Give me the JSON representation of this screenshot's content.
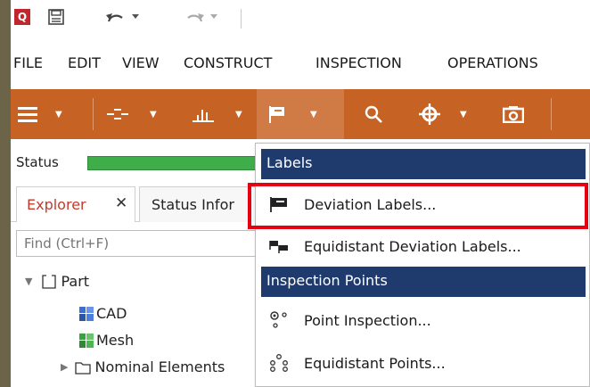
{
  "quick_access": {
    "logo_letter": "Q"
  },
  "menu": {
    "items": [
      "FILE",
      "EDIT",
      "VIEW",
      "CONSTRUCT",
      "INSPECTION",
      "OPERATIONS"
    ]
  },
  "toolbar": {
    "items": [
      "menu-icon",
      "align-icon",
      "chart-icon",
      "labels-icon",
      "search-icon",
      "crosshair-icon",
      "camera-icon"
    ],
    "active_item": "labels-icon"
  },
  "status": {
    "label": "Status"
  },
  "tabs": {
    "explorer": "Explorer",
    "explorer_close": "✕",
    "status_info": "Status Infor"
  },
  "search": {
    "placeholder": "Find (Ctrl+F)"
  },
  "tree": {
    "items": [
      {
        "label": "Part"
      },
      {
        "label": "CAD"
      },
      {
        "label": "Mesh"
      },
      {
        "label": "Nominal Elements"
      }
    ]
  },
  "dropdown": {
    "sections": [
      {
        "header": "Labels",
        "items": [
          {
            "label": "Deviation Labels...",
            "icon": "deviation-label-icon"
          },
          {
            "label": "Equidistant Deviation Labels...",
            "icon": "equidistant-label-icon"
          }
        ]
      },
      {
        "header": "Inspection Points",
        "items": [
          {
            "label": "Point Inspection...",
            "icon": "point-inspection-icon"
          },
          {
            "label": "Equidistant Points...",
            "icon": "equidistant-points-icon"
          }
        ]
      }
    ],
    "highlighted_item": "Deviation Labels...",
    "highlight_color": "#e50012",
    "header_color": "#1f3b6d"
  },
  "colors": {
    "toolbar": "#c56224",
    "status_progress": "#3fad49",
    "explorer_tab_text": "#c33a2a"
  }
}
